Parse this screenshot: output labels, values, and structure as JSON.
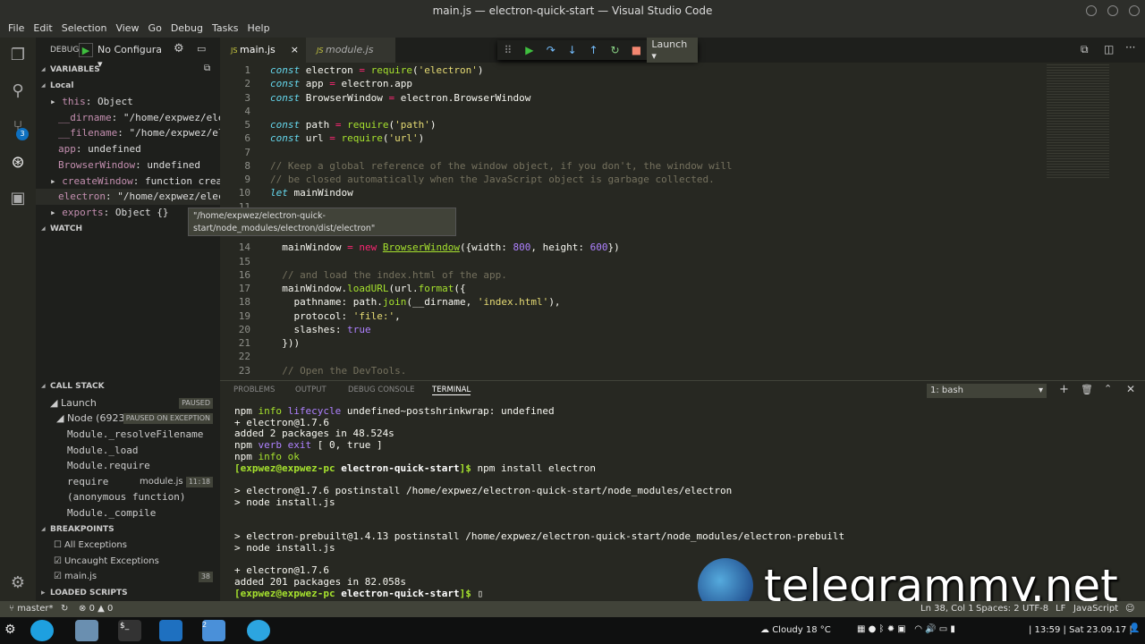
{
  "window": {
    "title": "main.js — electron-quick-start — Visual Studio Code"
  },
  "menu": [
    "File",
    "Edit",
    "Selection",
    "View",
    "Go",
    "Debug",
    "Tasks",
    "Help"
  ],
  "activity": {
    "scm_badge": "3"
  },
  "sidebar": {
    "debug_label": "DEBUG",
    "config": "No Configura",
    "variables_title": "VARIABLES",
    "local_title": "Local",
    "variables": [
      {
        "k": "this",
        "v": "Object",
        "exp": true
      },
      {
        "k": "__dirname",
        "v": "\"/home/expwez/ele…",
        "exp": false
      },
      {
        "k": "__filename",
        "v": "\"/home/expwez/el…",
        "exp": false
      },
      {
        "k": "app",
        "v": "undefined",
        "exp": false
      },
      {
        "k": "BrowserWindow",
        "v": "undefined",
        "exp": false
      },
      {
        "k": "createWindow",
        "v": "function creat…",
        "exp": true
      },
      {
        "k": "electron",
        "v": "\"/home/expwez/elec…",
        "exp": false
      },
      {
        "k": "exports",
        "v": "Object {}",
        "exp": true
      }
    ],
    "watch_title": "WATCH",
    "tooltip": "\"/home/expwez/electron-quick-start/node_modules/electron/dist/electron\"",
    "callstack_title": "CALL STACK",
    "launch": "Launch",
    "launch_state": "PAUSED",
    "node": "Node (6923)",
    "node_state": "PAUSED ON EXCEPTION",
    "frames": [
      {
        "name": "Module._resolveFilename"
      },
      {
        "name": "Module._load"
      },
      {
        "name": "Module.require"
      },
      {
        "name": "require",
        "file": "module.js",
        "pos": "11:18"
      },
      {
        "name": "(anonymous function)"
      },
      {
        "name": "Module._compile"
      }
    ],
    "breakpoints_title": "BREAKPOINTS",
    "breakpoints": [
      {
        "label": "All Exceptions",
        "checked": false
      },
      {
        "label": "Uncaught Exceptions",
        "checked": true
      },
      {
        "label": "main.js",
        "checked": true,
        "line": "38"
      }
    ],
    "loaded_title": "LOADED SCRIPTS"
  },
  "editor": {
    "tabs": [
      {
        "label": "main.js",
        "close": "×"
      },
      {
        "label": "module.js"
      }
    ],
    "launch": "Launch ▾",
    "lines": [
      {
        "n": "1",
        "t": [
          [
            "const",
            "kw"
          ],
          [
            " electron ",
            "tx"
          ],
          [
            "=",
            "op"
          ],
          [
            " ",
            "tx"
          ],
          [
            "require",
            "fn"
          ],
          [
            "(",
            "tx"
          ],
          [
            "'electron'",
            "str"
          ],
          [
            ")",
            "tx"
          ]
        ]
      },
      {
        "n": "2",
        "t": [
          [
            "const",
            "kw"
          ],
          [
            " app ",
            "tx"
          ],
          [
            "=",
            "op"
          ],
          [
            " electron.app",
            "tx"
          ]
        ]
      },
      {
        "n": "3",
        "t": [
          [
            "const",
            "kw"
          ],
          [
            " BrowserWindow ",
            "tx"
          ],
          [
            "=",
            "op"
          ],
          [
            " electron.BrowserWindow",
            "tx"
          ]
        ]
      },
      {
        "n": "4",
        "t": []
      },
      {
        "n": "5",
        "t": [
          [
            "const",
            "kw"
          ],
          [
            " path ",
            "tx"
          ],
          [
            "=",
            "op"
          ],
          [
            " ",
            "tx"
          ],
          [
            "require",
            "fn"
          ],
          [
            "(",
            "tx"
          ],
          [
            "'path'",
            "str"
          ],
          [
            ")",
            "tx"
          ]
        ]
      },
      {
        "n": "6",
        "t": [
          [
            "const",
            "kw"
          ],
          [
            " url ",
            "tx"
          ],
          [
            "=",
            "op"
          ],
          [
            " ",
            "tx"
          ],
          [
            "require",
            "fn"
          ],
          [
            "(",
            "tx"
          ],
          [
            "'url'",
            "str"
          ],
          [
            ")",
            "tx"
          ]
        ]
      },
      {
        "n": "7",
        "t": []
      },
      {
        "n": "8",
        "t": [
          [
            "// Keep a global reference of the window object, if you don't, the window will",
            "cm"
          ]
        ]
      },
      {
        "n": "9",
        "t": [
          [
            "// be closed automatically when the JavaScript object is garbage collected.",
            "cm"
          ]
        ]
      },
      {
        "n": "10",
        "t": [
          [
            "let",
            "kw"
          ],
          [
            " mainWindow",
            "tx"
          ]
        ]
      },
      {
        "n": "11",
        "t": []
      },
      {
        "n": "",
        "t": []
      },
      {
        "n": "",
        "t": []
      },
      {
        "n": "14",
        "t": [
          [
            "  mainWindow ",
            "tx"
          ],
          [
            "=",
            "op"
          ],
          [
            " ",
            "tx"
          ],
          [
            "new",
            "op"
          ],
          [
            " ",
            "tx"
          ],
          [
            "BrowserWindow",
            "cls"
          ],
          [
            "({width: ",
            "tx"
          ],
          [
            "800",
            "num"
          ],
          [
            ", height: ",
            "tx"
          ],
          [
            "600",
            "num"
          ],
          [
            "})",
            "tx"
          ]
        ]
      },
      {
        "n": "15",
        "t": []
      },
      {
        "n": "16",
        "t": [
          [
            "  // and load the index.html of the app.",
            "cm"
          ]
        ]
      },
      {
        "n": "17",
        "t": [
          [
            "  mainWindow.",
            "tx"
          ],
          [
            "loadURL",
            "fn"
          ],
          [
            "(url.",
            "tx"
          ],
          [
            "format",
            "fn"
          ],
          [
            "({",
            "tx"
          ]
        ]
      },
      {
        "n": "18",
        "t": [
          [
            "    pathname: path.",
            "tx"
          ],
          [
            "join",
            "fn"
          ],
          [
            "(__dirname, ",
            "tx"
          ],
          [
            "'index.html'",
            "str"
          ],
          [
            "),",
            "tx"
          ]
        ]
      },
      {
        "n": "19",
        "t": [
          [
            "    protocol: ",
            "tx"
          ],
          [
            "'file:'",
            "str"
          ],
          [
            ",",
            "tx"
          ]
        ]
      },
      {
        "n": "20",
        "t": [
          [
            "    slashes: ",
            "tx"
          ],
          [
            "true",
            "num"
          ]
        ]
      },
      {
        "n": "21",
        "t": [
          [
            "  }))",
            "tx"
          ]
        ]
      },
      {
        "n": "22",
        "t": []
      },
      {
        "n": "23",
        "t": [
          [
            "  // Open the DevTools.",
            "cm"
          ]
        ]
      }
    ]
  },
  "panel": {
    "tabs": [
      "PROBLEMS",
      "OUTPUT",
      "DEBUG CONSOLE",
      "TERMINAL"
    ],
    "terminal_select": "1: bash",
    "lines": [
      [
        [
          "npm ",
          "tx"
        ],
        [
          "info",
          "g2"
        ],
        [
          " ",
          "tx"
        ],
        [
          "lifecycle",
          "mg"
        ],
        [
          " undefined~postshrinkwrap: undefined",
          "tx"
        ]
      ],
      [
        [
          "+ electron@1.7.6",
          "tx"
        ]
      ],
      [
        [
          "added 2 packages in 48.524s",
          "tx"
        ]
      ],
      [
        [
          "npm ",
          "tx"
        ],
        [
          "verb",
          "mg"
        ],
        [
          " ",
          "tx"
        ],
        [
          "exit",
          "mg"
        ],
        [
          " [ 0, true ]",
          "tx"
        ]
      ],
      [
        [
          "npm ",
          "tx"
        ],
        [
          "info",
          "g2"
        ],
        [
          " ",
          "tx"
        ],
        [
          "ok",
          "g2"
        ]
      ],
      [
        [
          "[expwez@expwez-pc ",
          "g"
        ],
        [
          "electron-quick-start",
          "tb"
        ],
        [
          "]$ ",
          "g"
        ],
        [
          "npm install electron",
          "tx"
        ]
      ],
      [],
      [
        [
          "> electron@1.7.6 postinstall /home/expwez/electron-quick-start/node_modules/electron",
          "tx"
        ]
      ],
      [
        [
          "> node install.js",
          "tx"
        ]
      ],
      [],
      [],
      [
        [
          "> electron-prebuilt@1.4.13 postinstall /home/expwez/electron-quick-start/node_modules/electron-prebuilt",
          "tx"
        ]
      ],
      [
        [
          "> node install.js",
          "tx"
        ]
      ],
      [],
      [
        [
          "+ electron@1.7.6",
          "tx"
        ]
      ],
      [
        [
          "added 201 packages in 82.058s",
          "tx"
        ]
      ],
      [
        [
          "[expwez@expwez-pc ",
          "g"
        ],
        [
          "electron-quick-start",
          "tb"
        ],
        [
          "]$ ",
          "g"
        ],
        [
          "▯",
          "tx"
        ]
      ]
    ]
  },
  "status": {
    "branch": "master*",
    "errors": "0",
    "warnings": "0",
    "pos": "Ln 38, Col 1",
    "spaces": "Spaces: 2",
    "enc": "UTF-8",
    "eol": "LF",
    "lang": "JavaScript"
  },
  "taskbar": {
    "weather": "Cloudy 18 °C",
    "clock": "| 13:59 | Sat 23.09.17 |",
    "folder_badge": "2"
  },
  "watermark": "telegrammy.net"
}
